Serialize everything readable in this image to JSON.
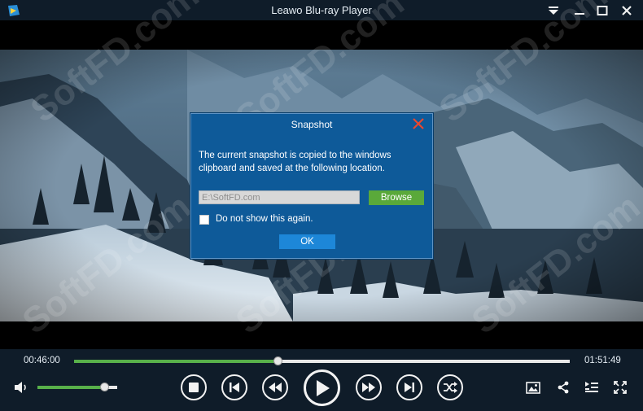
{
  "window": {
    "title": "Leawo Blu-ray Player"
  },
  "icons": {
    "app": "leawo-app-icon",
    "menu": "dropdown-triangle-icon",
    "minimize": "minimize-icon",
    "maximize": "maximize-icon",
    "close": "close-icon",
    "dialog_close": "close-x-icon",
    "volume": "speaker-icon",
    "stop": "stop-icon",
    "prev": "previous-chapter-icon",
    "rewind": "rewind-icon",
    "play": "play-icon",
    "forward": "fast-forward-icon",
    "next": "next-chapter-icon",
    "shuffle": "shuffle-icon",
    "snapshot": "snapshot-image-icon",
    "share": "share-icon",
    "playlist": "playlist-icon",
    "fullscreen": "fullscreen-icon"
  },
  "dialog": {
    "title": "Snapshot",
    "message": "The current snapshot is copied to the windows clipboard and saved at the following location.",
    "path_value": "E:\\SoftFD.com",
    "browse_label": "Browse",
    "checkbox_label": "Do not show this again.",
    "checkbox_checked": false,
    "ok_label": "OK"
  },
  "player": {
    "elapsed": "00:46:00",
    "total": "01:51:49",
    "progress_fraction": 0.411,
    "volume_fraction": 0.84
  },
  "watermark": {
    "text": "SoftFD.com"
  },
  "colors": {
    "accent_green": "#58b04a",
    "dialog_blue": "#0e5a99",
    "ok_blue": "#1d87d8",
    "close_red": "#e8472f"
  }
}
